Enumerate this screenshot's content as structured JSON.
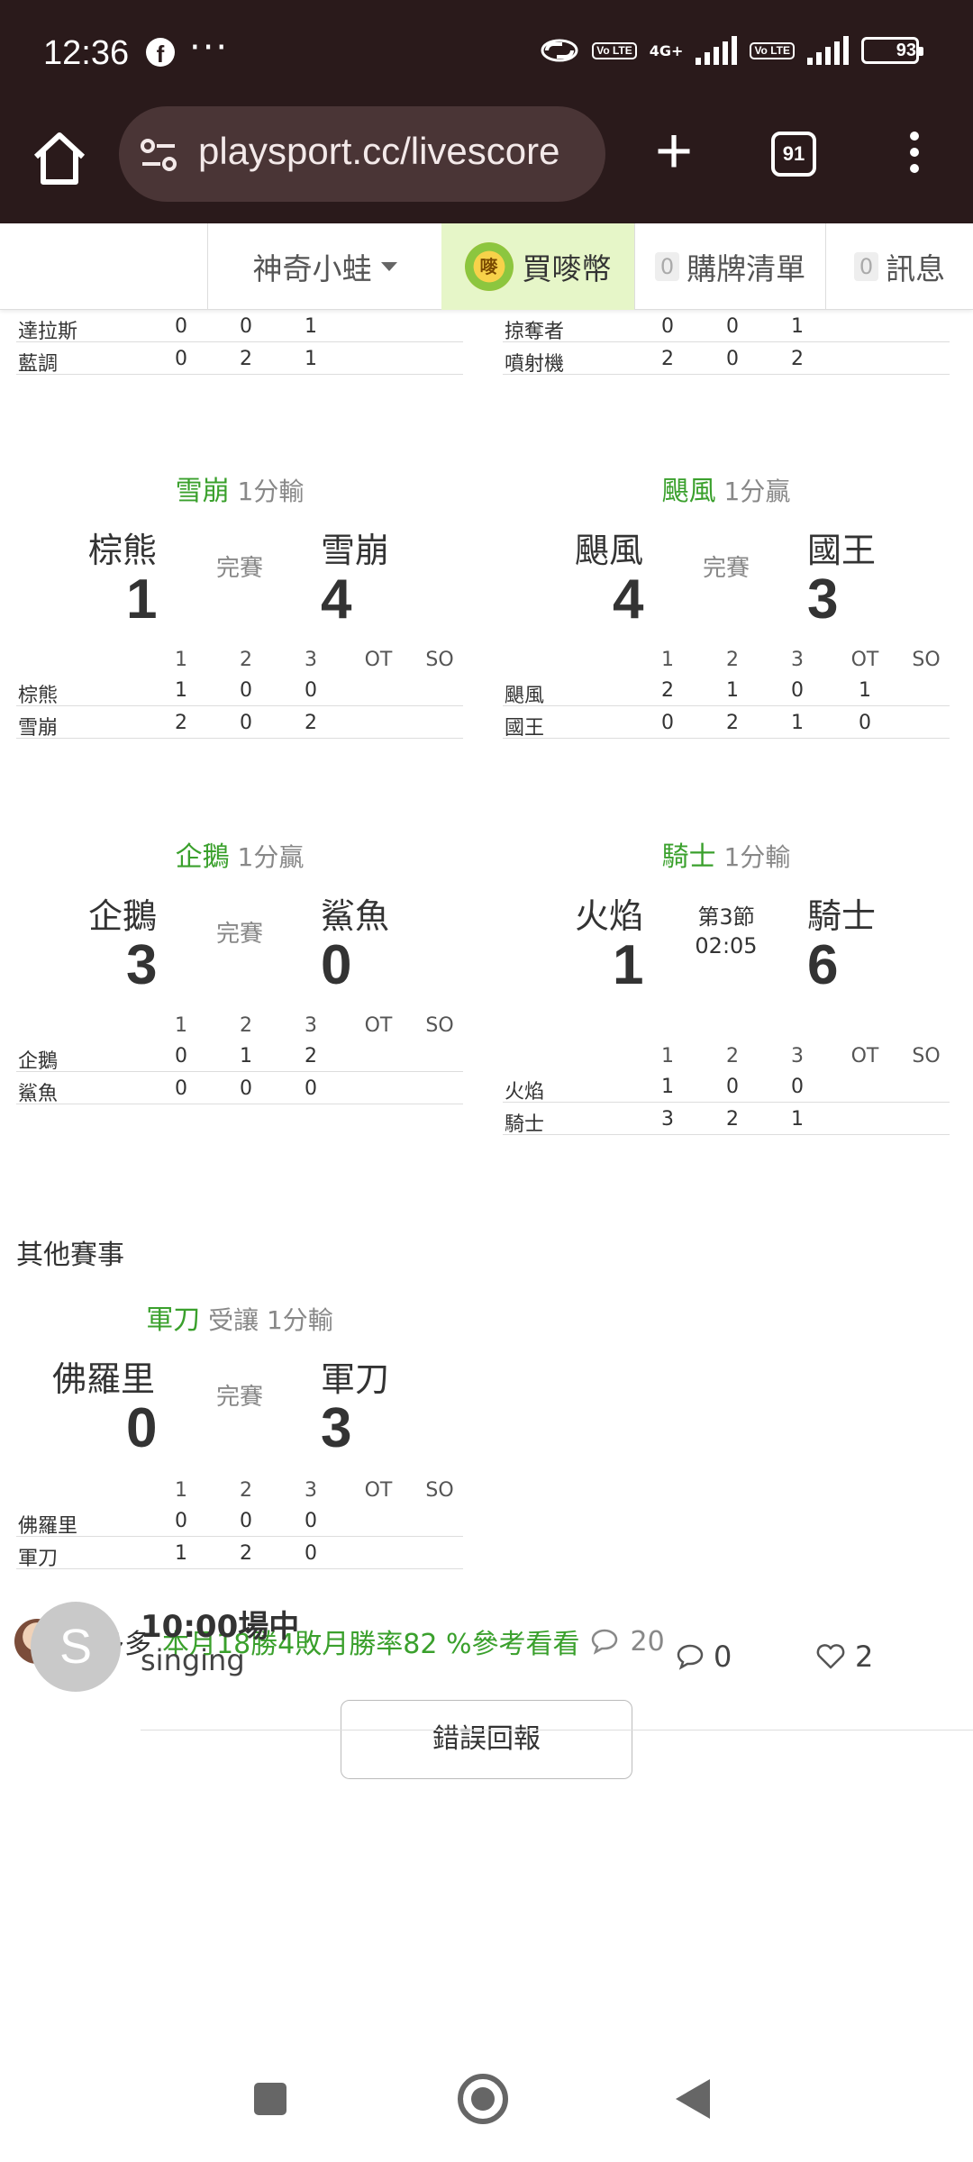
{
  "status_bar": {
    "time": "12:36",
    "facebook_icon": "f",
    "dots": "···",
    "network": "4G+",
    "volte_1": "Vo LTE",
    "volte_2": "Vo LTE",
    "battery": "93"
  },
  "browser": {
    "url": "playsport.cc/livescore",
    "tab_count": "91"
  },
  "site_nav": {
    "user": "神奇小蛙",
    "coin_icon_text": "嘜",
    "buy": "買嘜幣",
    "cart_count": "0",
    "cart": "購牌清單",
    "msg_count": "0",
    "messages": "訊息"
  },
  "period_headers": [
    "1",
    "2",
    "3",
    "OT",
    "SO"
  ],
  "games": [
    {
      "rows": [
        {
          "team": "達拉斯",
          "p": [
            "0",
            "0",
            "1",
            "",
            ""
          ]
        },
        {
          "team": "藍調",
          "p": [
            "0",
            "2",
            "1",
            "",
            ""
          ]
        }
      ]
    },
    {
      "rows": [
        {
          "team": "掠奪者",
          "p": [
            "0",
            "0",
            "1",
            "",
            ""
          ]
        },
        {
          "team": "噴射機",
          "p": [
            "2",
            "0",
            "2",
            "",
            ""
          ]
        }
      ]
    },
    {
      "winner": "雪崩",
      "note": "1分輸",
      "away": "棕熊",
      "away_score": "1",
      "home": "雪崩",
      "home_score": "4",
      "status": "完賽",
      "rows": [
        {
          "team": "棕熊",
          "p": [
            "1",
            "0",
            "0",
            "",
            ""
          ]
        },
        {
          "team": "雪崩",
          "p": [
            "2",
            "0",
            "2",
            "",
            ""
          ]
        }
      ]
    },
    {
      "winner": "颶風",
      "note": "1分贏",
      "away": "颶風",
      "away_score": "4",
      "home": "國王",
      "home_score": "3",
      "status": "完賽",
      "rows": [
        {
          "team": "颶風",
          "p": [
            "2",
            "1",
            "0",
            "1",
            ""
          ]
        },
        {
          "team": "國王",
          "p": [
            "0",
            "2",
            "1",
            "0",
            ""
          ]
        }
      ]
    },
    {
      "winner": "企鵝",
      "note": "1分贏",
      "away": "企鵝",
      "away_score": "3",
      "home": "鯊魚",
      "home_score": "0",
      "status": "完賽",
      "rows": [
        {
          "team": "企鵝",
          "p": [
            "0",
            "1",
            "2",
            "",
            ""
          ]
        },
        {
          "team": "鯊魚",
          "p": [
            "0",
            "0",
            "0",
            "",
            ""
          ]
        }
      ]
    },
    {
      "winner": "騎士",
      "note": "1分輸",
      "away": "火焰",
      "away_score": "1",
      "home": "騎士",
      "home_score": "6",
      "status_line1": "第3節",
      "status_line2": "02:05",
      "rows": [
        {
          "team": "火焰",
          "p": [
            "1",
            "0",
            "0",
            "",
            ""
          ]
        },
        {
          "team": "騎士",
          "p": [
            "3",
            "2",
            "1",
            "",
            ""
          ]
        }
      ]
    },
    {
      "winner": "軍刀",
      "note": "受讓 1分輸",
      "away": "佛羅里",
      "away_score": "0",
      "home": "軍刀",
      "home_score": "3",
      "status": "完賽",
      "rows": [
        {
          "team": "佛羅里",
          "p": [
            "0",
            "0",
            "0",
            "",
            ""
          ]
        },
        {
          "team": "軍刀",
          "p": [
            "1",
            "2",
            "0",
            "",
            ""
          ]
        }
      ]
    }
  ],
  "other_games_title": "其他賽事",
  "tipster": {
    "name": "李多多",
    "link": "本月18勝4敗月勝率82 %參考看看",
    "comments": "20"
  },
  "report_button": "錯誤回報",
  "post": {
    "avatar_letter": "S",
    "title": "10:00場中",
    "user": "singing",
    "comments": "0",
    "likes": "2"
  }
}
